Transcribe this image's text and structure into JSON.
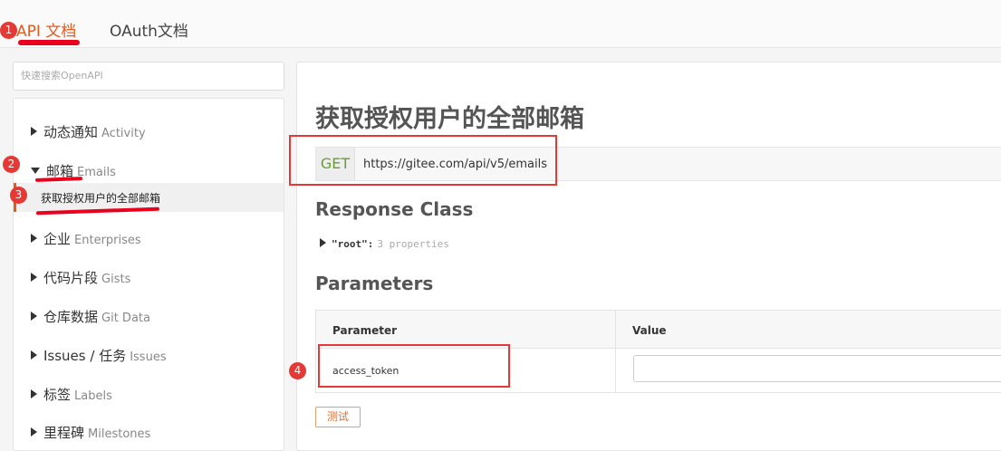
{
  "header": {
    "tabs": [
      {
        "label": "API 文档",
        "active": true
      },
      {
        "label": "OAuth文档",
        "active": false
      }
    ]
  },
  "search": {
    "placeholder": "快速搜索OpenAPI"
  },
  "sidebar": {
    "items": [
      {
        "label": "动态通知",
        "en": "Activity",
        "expanded": false
      },
      {
        "label": "邮箱",
        "en": "Emails",
        "expanded": true
      },
      {
        "label": "企业",
        "en": "Enterprises",
        "expanded": false
      },
      {
        "label": "代码片段",
        "en": "Gists",
        "expanded": false
      },
      {
        "label": "仓库数据",
        "en": "Git Data",
        "expanded": false
      },
      {
        "label": "Issues / 任务",
        "en": "Issues",
        "expanded": false
      },
      {
        "label": "标签",
        "en": "Labels",
        "expanded": false
      },
      {
        "label": "里程碑",
        "en": "Milestones",
        "expanded": false
      }
    ],
    "active_sub_item": "获取授权用户的全部邮箱"
  },
  "main": {
    "title": "获取授权用户的全部邮箱",
    "method": "GET",
    "url": "https://gitee.com/api/v5/emails",
    "response_class_heading": "Response Class",
    "model": {
      "root": "\"root\":",
      "props": "3 properties"
    },
    "parameters_heading": "Parameters",
    "table": {
      "headers": [
        "Parameter",
        "Value"
      ],
      "rows": [
        {
          "parameter": "access_token",
          "value": ""
        }
      ]
    },
    "test_button": "测试"
  },
  "annotations": {
    "badges": [
      "1",
      "2",
      "3",
      "4"
    ]
  },
  "colors": {
    "accent": "#e85a1c",
    "method_get": "#6a9a3a",
    "annotation_red": "#e53935"
  }
}
